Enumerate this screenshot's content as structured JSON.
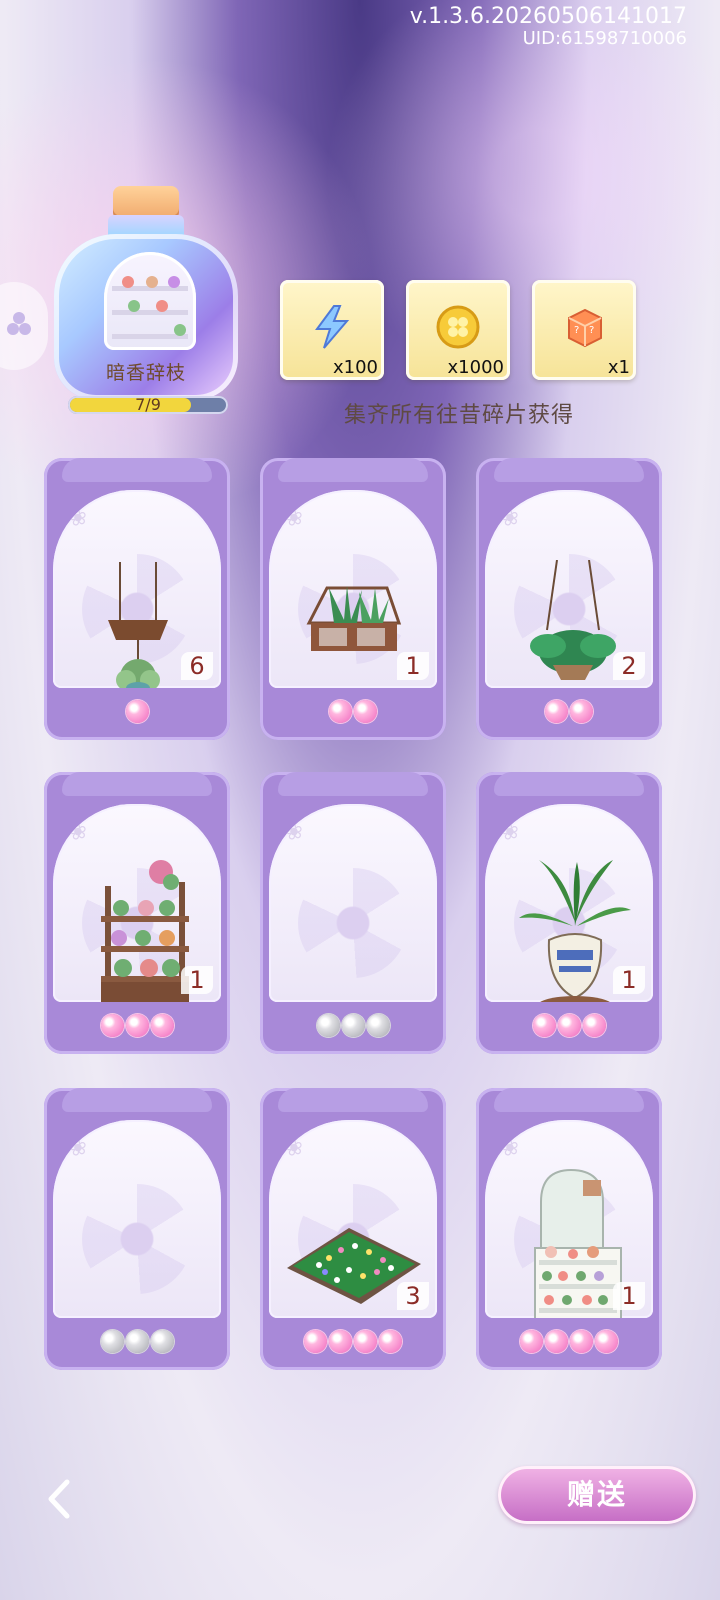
{
  "header": {
    "version": "v.1.3.6.20260506141017",
    "uid": "UID:61598710006"
  },
  "collection": {
    "title": "暗香辞枝",
    "progress_text": "7/9",
    "progress": 0.7778
  },
  "rewards": [
    {
      "icon": "lightning-icon",
      "count": "x100"
    },
    {
      "icon": "coin-icon",
      "count": "x1000"
    },
    {
      "icon": "mystery-box-icon",
      "count": "x1"
    }
  ],
  "reward_caption": "集齐所有往昔碎片获得",
  "cards": [
    {
      "art": "hanging-shelf-plant",
      "count": "6",
      "pearls": 1,
      "pearl_color": "pink"
    },
    {
      "art": "glass-terrarium",
      "count": "1",
      "pearls": 2,
      "pearl_color": "pink"
    },
    {
      "art": "hanging-fern",
      "count": "2",
      "pearls": 2,
      "pearl_color": "pink"
    },
    {
      "art": "flower-shelf",
      "count": "1",
      "pearls": 3,
      "pearl_color": "pink"
    },
    {
      "art": "empty",
      "count": "",
      "pearls": 3,
      "pearl_color": "silver"
    },
    {
      "art": "potted-plant",
      "count": "1",
      "pearls": 3,
      "pearl_color": "pink"
    },
    {
      "art": "empty",
      "count": "",
      "pearls": 3,
      "pearl_color": "silver"
    },
    {
      "art": "flower-bed",
      "count": "3",
      "pearls": 4,
      "pearl_color": "pink"
    },
    {
      "art": "white-shelf",
      "count": "1",
      "pearls": 4,
      "pearl_color": "pink"
    }
  ],
  "buttons": {
    "back_icon": "back-arrow-icon",
    "send": "赠送"
  },
  "colors": {
    "accent": "#a889d8",
    "button": "#d486d2",
    "text_brown": "#6f4b2d"
  },
  "icons": {
    "left_tab": "flower-petal-icon"
  }
}
